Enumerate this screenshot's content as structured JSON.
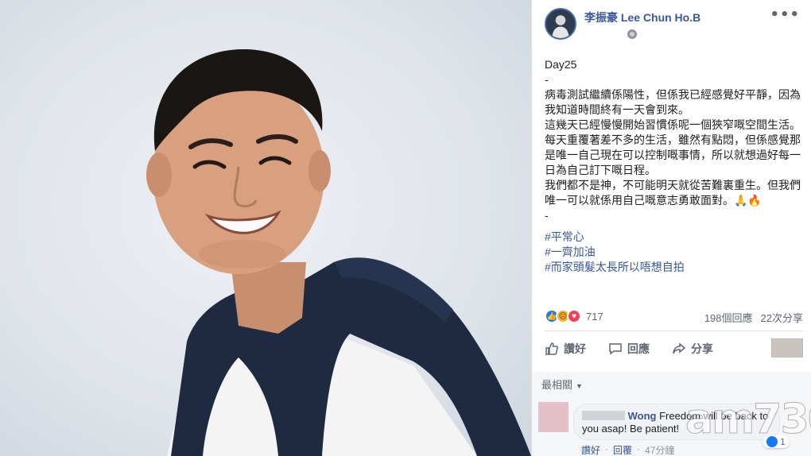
{
  "post": {
    "author": "李振豪 Lee Chun Ho.B",
    "more_icon": "more-horizontal-icon",
    "privacy_icon": "globe-icon",
    "paragraphs": [
      "Day25",
      "-",
      "病毒測試繼續係陽性，但係我已經感覺好平靜，因為我知道時間終有一天會到來。",
      "這幾天已經慢慢開始習慣係呢一個狹窄嘅空間生活。",
      "每天重覆著差不多的生活，雖然有點悶，但係感覺那是唯一自己現在可以控制嘅事情，所以就想過好每一日為自己訂下嘅日程。",
      "我們都不是神，不可能明天就從苦難裏重生。但我們唯一可以就係用自己嘅意志勇敢面對。🙏🔥",
      "-"
    ],
    "hashtags": [
      "#平常心",
      "#一齊加油",
      "#而家頭髮太長所以唔想自拍"
    ]
  },
  "stats": {
    "reaction_count": "717",
    "comments": "198個回應",
    "shares": "22次分享"
  },
  "actions": {
    "like": "讚好",
    "comment": "回應",
    "share": "分享"
  },
  "sort": {
    "label": "最相關"
  },
  "comment": {
    "name": "Wong",
    "text": "Freedom will be back to you asap! Be patient!",
    "like_count": "1",
    "like": "讚好",
    "reply": "回覆",
    "time": "47分鐘"
  },
  "watermark": "am730",
  "colors": {
    "link": "#385898",
    "muted": "#606770",
    "divider": "#dddfe2",
    "like_blue": "#1877f2"
  }
}
